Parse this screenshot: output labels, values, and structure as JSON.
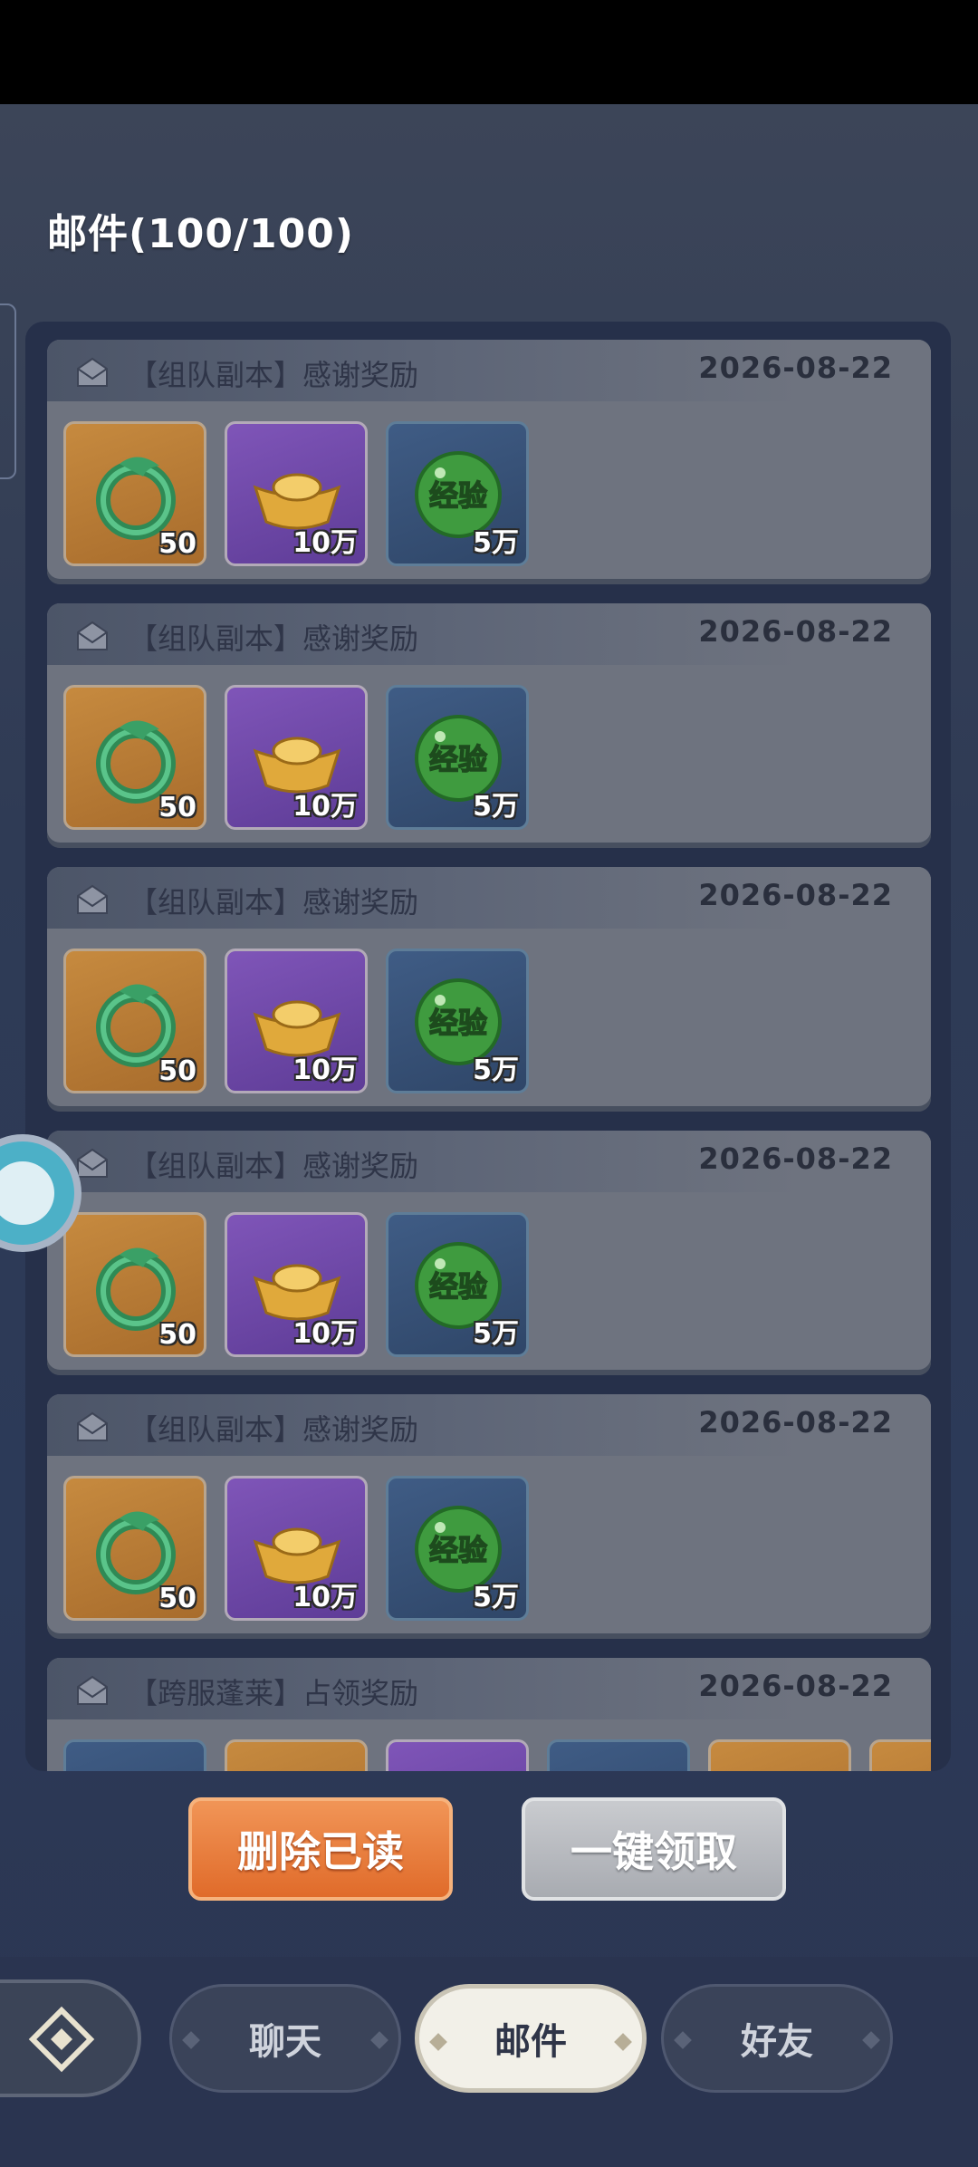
{
  "title": "邮件(100/100)",
  "mails": [
    {
      "title": "【组队副本】感谢奖励",
      "date": "2026-08-22",
      "items": [
        {
          "icon": "jade-dragon-icon",
          "type": "jade",
          "qty": "50"
        },
        {
          "icon": "gold-ingot-icon",
          "type": "gold",
          "qty": "10万"
        },
        {
          "icon": "exp-orb-icon",
          "type": "exp",
          "label": "经验",
          "qty": "5万"
        }
      ]
    },
    {
      "title": "【组队副本】感谢奖励",
      "date": "2026-08-22",
      "items": [
        {
          "icon": "jade-dragon-icon",
          "type": "jade",
          "qty": "50"
        },
        {
          "icon": "gold-ingot-icon",
          "type": "gold",
          "qty": "10万"
        },
        {
          "icon": "exp-orb-icon",
          "type": "exp",
          "label": "经验",
          "qty": "5万"
        }
      ]
    },
    {
      "title": "【组队副本】感谢奖励",
      "date": "2026-08-22",
      "items": [
        {
          "icon": "jade-dragon-icon",
          "type": "jade",
          "qty": "50"
        },
        {
          "icon": "gold-ingot-icon",
          "type": "gold",
          "qty": "10万"
        },
        {
          "icon": "exp-orb-icon",
          "type": "exp",
          "label": "经验",
          "qty": "5万"
        }
      ]
    },
    {
      "title": "【组队副本】感谢奖励",
      "date": "2026-08-22",
      "items": [
        {
          "icon": "jade-dragon-icon",
          "type": "jade",
          "qty": "50"
        },
        {
          "icon": "gold-ingot-icon",
          "type": "gold",
          "qty": "10万"
        },
        {
          "icon": "exp-orb-icon",
          "type": "exp",
          "label": "经验",
          "qty": "5万"
        }
      ]
    },
    {
      "title": "【组队副本】感谢奖励",
      "date": "2026-08-22",
      "items": [
        {
          "icon": "jade-dragon-icon",
          "type": "jade",
          "qty": "50"
        },
        {
          "icon": "gold-ingot-icon",
          "type": "gold",
          "qty": "10万"
        },
        {
          "icon": "exp-orb-icon",
          "type": "exp",
          "label": "经验",
          "qty": "5万"
        }
      ]
    },
    {
      "title": "【跨服蓬莱】占领奖励",
      "date": "2026-08-22",
      "items": []
    }
  ],
  "buttons": {
    "delete_read": "删除已读",
    "claim_all": "一键领取"
  },
  "nav": {
    "tabs": [
      {
        "label": "聊天"
      },
      {
        "label": "邮件"
      },
      {
        "label": "好友"
      }
    ],
    "active": "邮件"
  },
  "colors": {
    "delete_button": "#e8793a",
    "claim_button": "#b9bcc1",
    "panel": "#26304a",
    "mail_card": "#6e737f"
  }
}
